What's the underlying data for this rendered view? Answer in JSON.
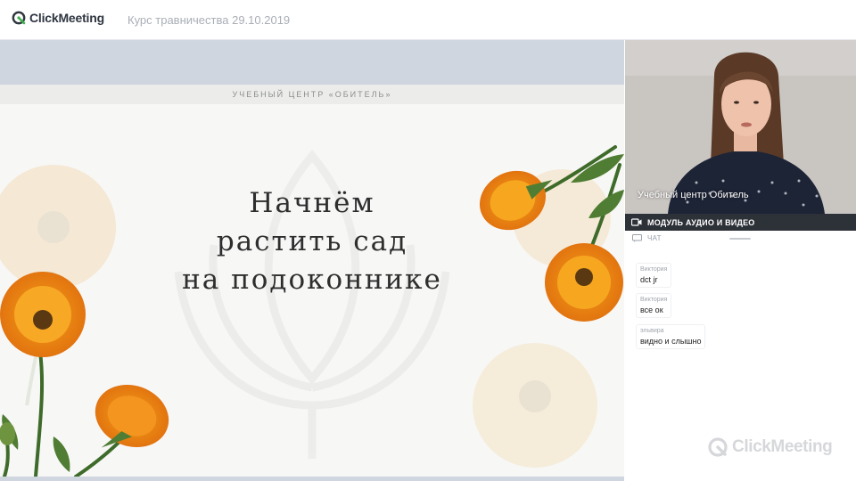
{
  "app": {
    "logo_text": "ClickMeeting",
    "meeting_title": "Курс травничества 29.10.2019"
  },
  "slide": {
    "header": "УЧЕБНЫЙ ЦЕНТР «ОБИТЕЛЬ»",
    "title_lines": [
      "Начнём",
      "растить сад",
      "на подоконнике"
    ]
  },
  "video": {
    "presenter_name": "Учебный центр Обитель"
  },
  "av_module": {
    "label": "МОДУЛЬ АУДИО И ВИДЕО",
    "icon": "video-camera-icon"
  },
  "chat": {
    "label": "ЧАТ",
    "icon": "chat-icon",
    "messages": [
      {
        "author": "Виктория",
        "text": "dct jr"
      },
      {
        "author": "Виктория",
        "text": "все ок"
      },
      {
        "author": "эльвира",
        "text": "видно и слышно"
      }
    ]
  },
  "watermark": {
    "text": "ClickMeeting"
  },
  "colors": {
    "accent_green": "#3fb14d",
    "dark_bar": "#2d3138",
    "stage_bg": "#cfd6e0",
    "flower_orange": "#ee8a1a"
  }
}
